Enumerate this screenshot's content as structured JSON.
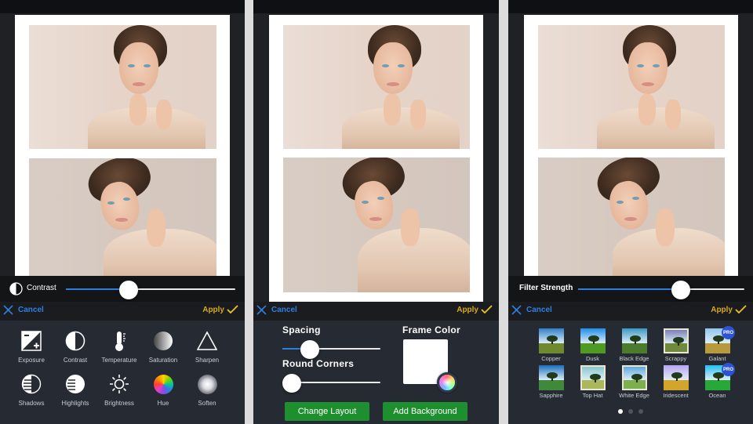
{
  "screens": [
    {
      "id": "adjust",
      "slider": {
        "label": "Contrast",
        "icon": "contrast-icon",
        "value": 0.37
      },
      "actions": {
        "cancel": "Cancel",
        "apply": "Apply"
      },
      "tools": [
        {
          "label": "Exposure",
          "icon": "exposure-icon"
        },
        {
          "label": "Contrast",
          "icon": "contrast-icon"
        },
        {
          "label": "Temperature",
          "icon": "thermometer-icon"
        },
        {
          "label": "Saturation",
          "icon": "saturation-icon"
        },
        {
          "label": "Sharpen",
          "icon": "triangle-icon"
        },
        {
          "label": "Shadows",
          "icon": "shadows-icon"
        },
        {
          "label": "Highlights",
          "icon": "highlights-icon"
        },
        {
          "label": "Brightness",
          "icon": "sun-icon"
        },
        {
          "label": "Hue",
          "icon": "color-wheel-icon"
        },
        {
          "label": "Soften",
          "icon": "soften-icon"
        }
      ]
    },
    {
      "id": "frame",
      "actions": {
        "cancel": "Cancel",
        "apply": "Apply"
      },
      "spacing": {
        "label": "Spacing",
        "value": 0.28
      },
      "round_corners": {
        "label": "Round Corners",
        "value": 0.0
      },
      "frame_color": {
        "label": "Frame Color",
        "color": "#ffffff"
      },
      "buttons": {
        "change_layout": "Change Layout",
        "add_background": "Add Background"
      }
    },
    {
      "id": "filters",
      "slider": {
        "label": "Filter Strength",
        "value": 0.62
      },
      "actions": {
        "cancel": "Cancel",
        "apply": "Apply"
      },
      "filters": [
        {
          "label": "Copper",
          "sky": "#2f7fc8",
          "grass": "#6f8a2e",
          "pro": false
        },
        {
          "label": "Dusk",
          "sky": "#1e8ee8",
          "grass": "#4f9a22",
          "pro": false
        },
        {
          "label": "Black Edge",
          "sky": "#3a97c4",
          "grass": "#4c7c2b",
          "pro": false
        },
        {
          "label": "Scrappy",
          "sky": "#7a7fb6",
          "grass": "#6f8a3a",
          "pro": false
        },
        {
          "label": "Galant",
          "sky": "#8fc6ee",
          "grass": "#b79a3c",
          "pro": true,
          "pro_label": "PRO"
        },
        {
          "label": "Sapphire",
          "sky": "#1b6fc0",
          "grass": "#3f8a3a",
          "pro": false
        },
        {
          "label": "Top Hat",
          "sky": "#8cc7cf",
          "grass": "#aab85a",
          "pro": false
        },
        {
          "label": "White Edge",
          "sky": "#5fa9dd",
          "grass": "#7db04a",
          "pro": false
        },
        {
          "label": "Iridescent",
          "sky": "#b8a5ef",
          "grass": "#d3a52a",
          "pro": false
        },
        {
          "label": "Ocean",
          "sky": "#22c0f0",
          "grass": "#27a838",
          "pro": true,
          "pro_label": "PRO"
        }
      ],
      "pagination": {
        "pages": 3,
        "current": 1
      }
    }
  ],
  "colors": {
    "accent_blue": "#2f7de1",
    "apply_gold": "#d7a91d",
    "button_green": "#1e8f2e",
    "pro_badge": "#2c53d6"
  }
}
